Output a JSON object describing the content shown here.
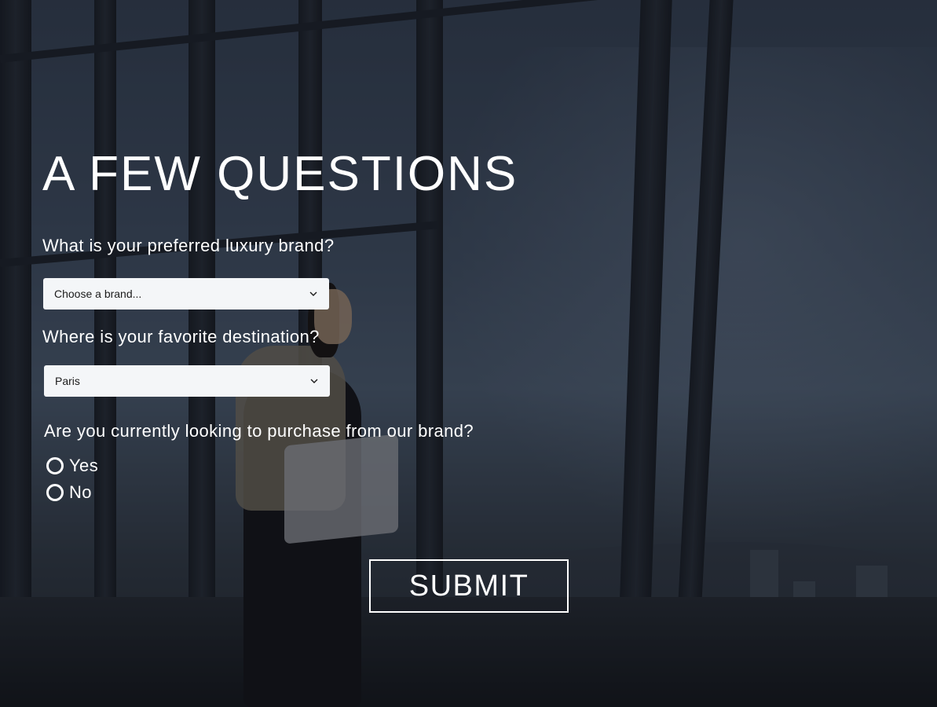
{
  "page": {
    "title": "A FEW QUESTIONS"
  },
  "form": {
    "brand_question": "What is your preferred luxury brand?",
    "brand_select": {
      "value": "Choose a brand..."
    },
    "destination_question": "Where is your favorite destination?",
    "destination_select": {
      "value": "Paris"
    },
    "purchase_question": "Are you currently looking to purchase from our brand?",
    "purchase_options": [
      {
        "label": "Yes",
        "selected": false
      },
      {
        "label": "No",
        "selected": false
      }
    ],
    "submit_label": "SUBMIT"
  },
  "icons": {
    "select_chevron": "chevron-down-icon",
    "radio": "radio-unchecked-icon"
  },
  "colors": {
    "text": "#ffffff",
    "select_background": "#f4f6f8",
    "select_text": "#1b1b1b",
    "overlay": "rgba(10,14,20,0.45)"
  }
}
